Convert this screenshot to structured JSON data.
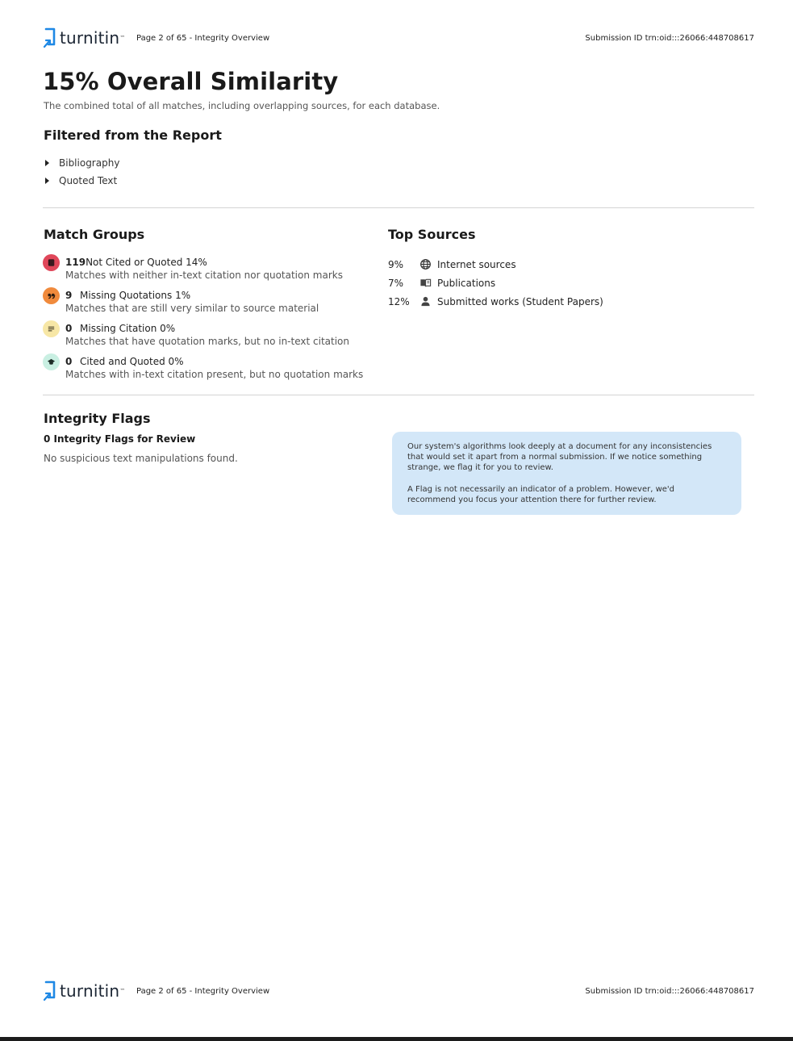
{
  "header": {
    "logo_text": "turnitin",
    "logo_tm": "™",
    "page_info": "Page 2 of 65 - Integrity Overview",
    "submission_id": "Submission ID trn:oid:::26066:448708617"
  },
  "overview": {
    "title": "15% Overall Similarity",
    "subtitle": "The combined total of all matches, including overlapping sources, for each database."
  },
  "filtered": {
    "heading": "Filtered from the Report",
    "items": [
      "Bibliography",
      "Quoted Text"
    ]
  },
  "match_groups": {
    "heading": "Match Groups",
    "items": [
      {
        "count": "119",
        "label": "Not Cited or Quoted 14%",
        "description": "Matches with neither in-text citation nor quotation marks",
        "icon": "not-cited-icon",
        "color": "#e0475a"
      },
      {
        "count": "9",
        "label": "Missing Quotations 1%",
        "description": "Matches that are still very similar to source material",
        "icon": "quotation-icon",
        "color": "#f08a3c"
      },
      {
        "count": "0",
        "label": "Missing Citation 0%",
        "description": "Matches that have quotation marks, but no in-text citation",
        "icon": "text-lines-icon",
        "color": "#f7e7a6"
      },
      {
        "count": "0",
        "label": "Cited and Quoted 0%",
        "description": "Matches with in-text citation present, but no quotation marks",
        "icon": "graduation-cap-icon",
        "color": "#c9efe2"
      }
    ]
  },
  "top_sources": {
    "heading": "Top Sources",
    "items": [
      {
        "percent": "9%",
        "label": "Internet sources",
        "icon": "globe-icon"
      },
      {
        "percent": "7%",
        "label": "Publications",
        "icon": "book-icon"
      },
      {
        "percent": "12%",
        "label": "Submitted works (Student Papers)",
        "icon": "person-icon"
      }
    ]
  },
  "integrity_flags": {
    "heading": "Integrity Flags",
    "count_label": "0 Integrity Flags for Review",
    "none_text": "No suspicious text manipulations found.",
    "info_paragraph_1": "Our system's algorithms look deeply at a document for any inconsistencies that would set it apart from a normal submission. If we notice something strange, we flag it for you to review.",
    "info_paragraph_2": "A Flag is not necessarily an indicator of a problem. However, we'd recommend you focus your attention there for further review."
  },
  "footer": {
    "logo_text": "turnitin",
    "logo_tm": "™",
    "page_info": "Page 2 of 65 - Integrity Overview",
    "submission_id": "Submission ID trn:oid:::26066:448708617"
  }
}
